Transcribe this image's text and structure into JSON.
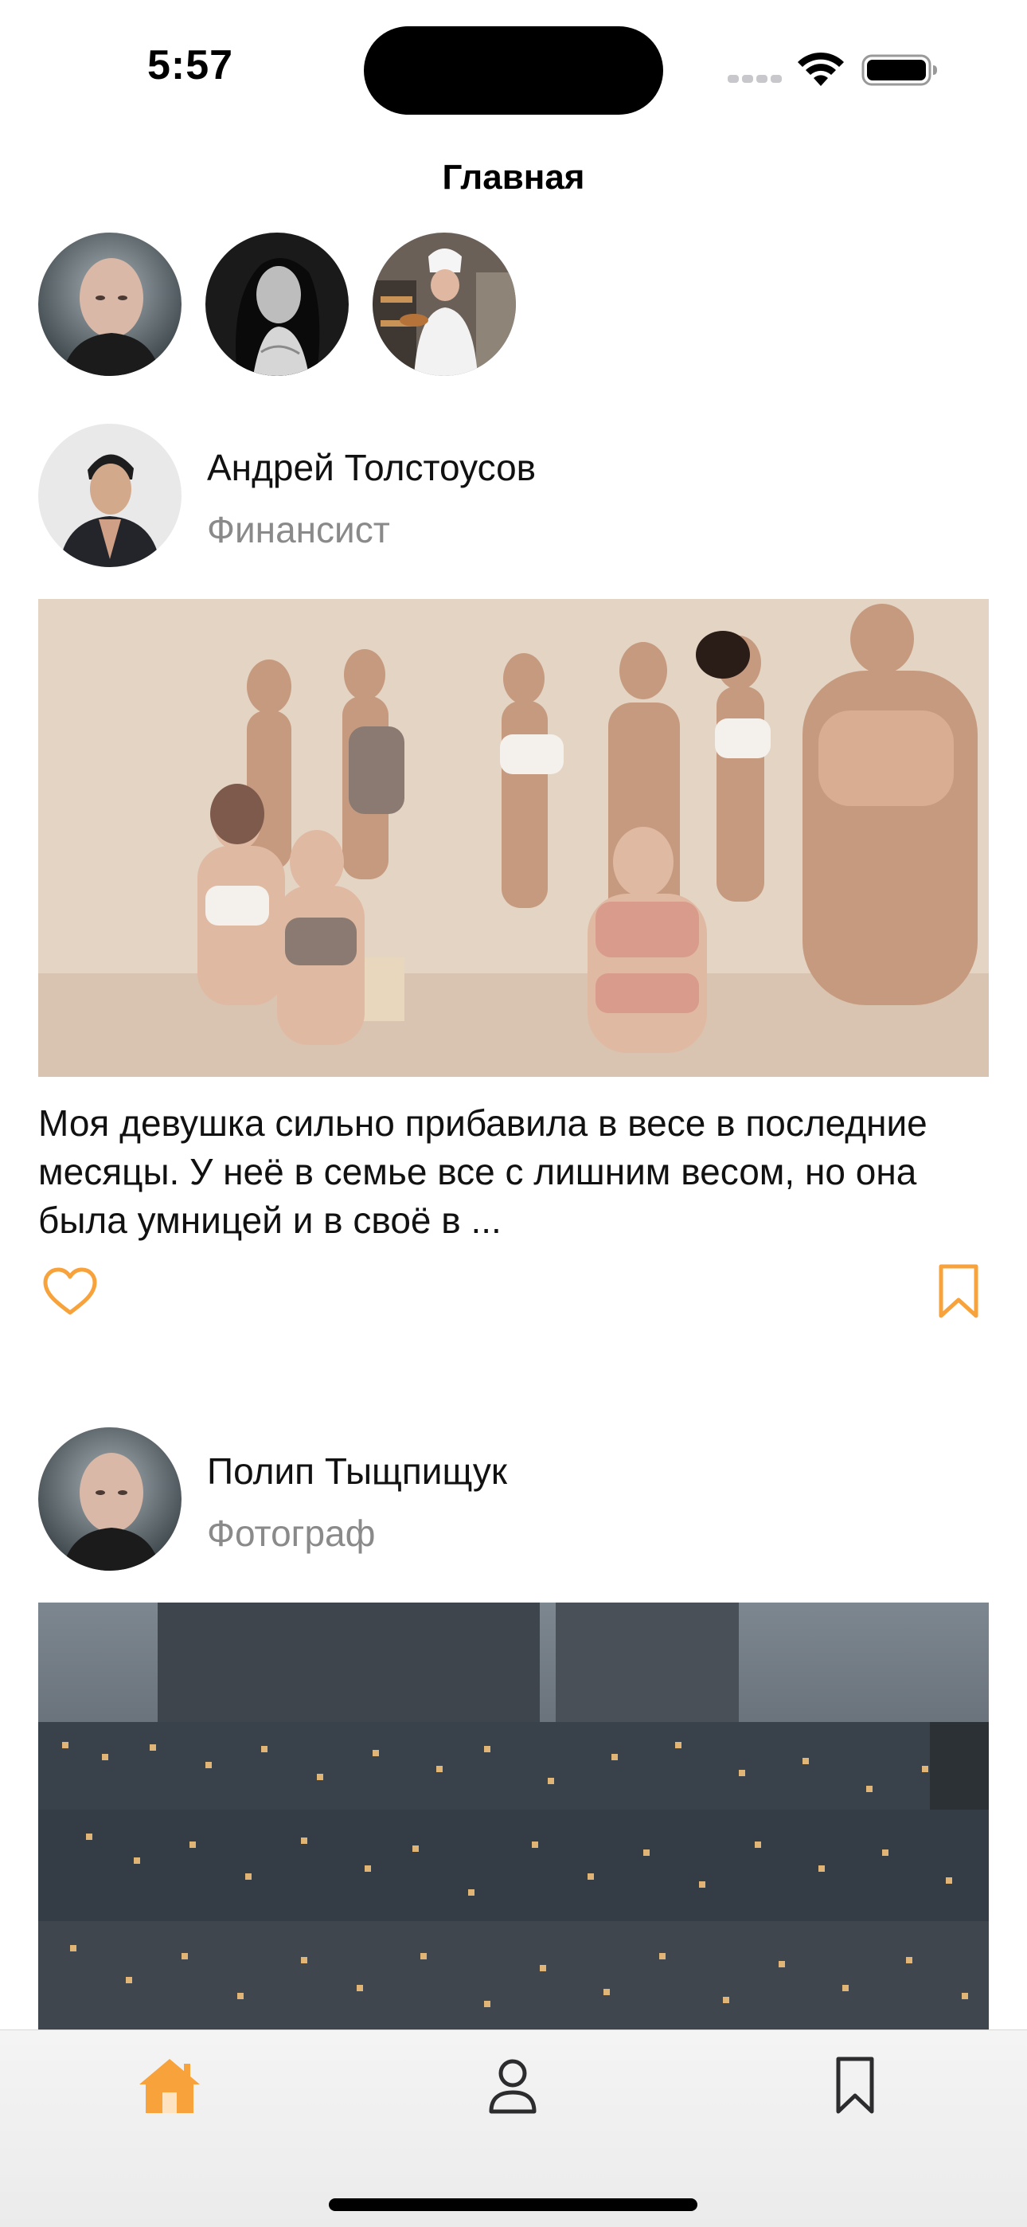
{
  "status_bar": {
    "time": "5:57",
    "icons": [
      "cellular-signal-icon",
      "wifi-icon",
      "battery-icon"
    ]
  },
  "nav": {
    "title": "Главная"
  },
  "stories": [
    {
      "avatar": "bald-man-portrait"
    },
    {
      "avatar": "woman-bw-portrait"
    },
    {
      "avatar": "chef-bakery-portrait"
    }
  ],
  "posts": [
    {
      "author_name": "Андрей Толстоусов",
      "author_role": "Финансист",
      "image": "group-women-photo",
      "text": "Моя девушка сильно прибавила в весе в последние месяцы. У неё в семье все с лишним весом, но она была умницей и в своё в ...",
      "like_icon": "heart-outline-icon",
      "bookmark_icon": "bookmark-outline-icon"
    },
    {
      "author_name": "Полип Тыщпищук",
      "author_role": "Фотограф",
      "image": "city-apartment-blocks-dusk-photo"
    }
  ],
  "tab_bar": {
    "tabs": [
      {
        "name": "home",
        "icon": "house-fill-icon",
        "active": true
      },
      {
        "name": "profile",
        "icon": "person-icon",
        "active": false
      },
      {
        "name": "bookmarks",
        "icon": "bookmark-icon",
        "active": false
      }
    ]
  },
  "colors": {
    "accent": "#F7A23B",
    "secondary_text": "#8A8A8A",
    "tab_inactive": "#2C2C2E"
  }
}
